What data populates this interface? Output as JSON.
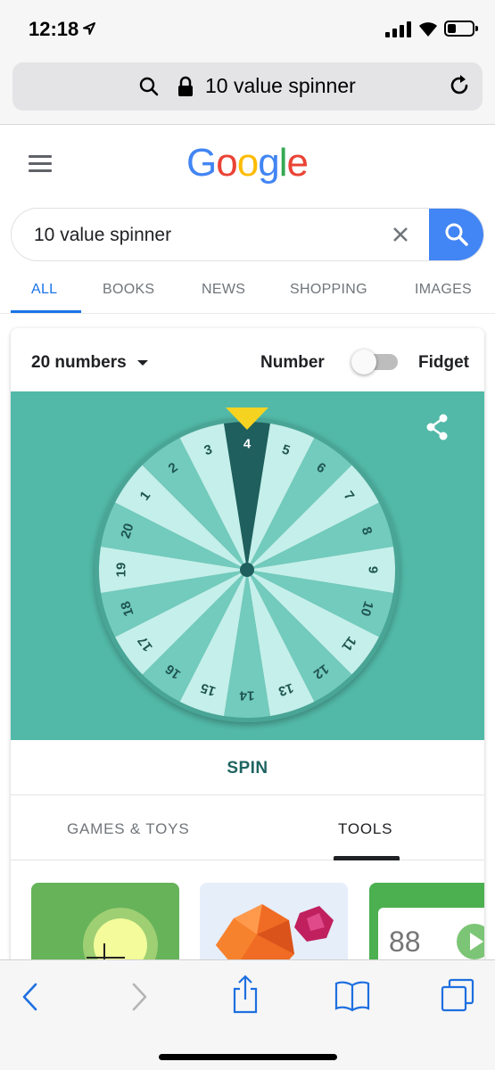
{
  "status": {
    "time": "12:18"
  },
  "browser": {
    "url_text": "10 value spinner"
  },
  "google": {
    "logo": [
      {
        "ch": "G",
        "color": "#4285f4"
      },
      {
        "ch": "o",
        "color": "#ea4335"
      },
      {
        "ch": "o",
        "color": "#fbbc05"
      },
      {
        "ch": "g",
        "color": "#4285f4"
      },
      {
        "ch": "l",
        "color": "#34a853"
      },
      {
        "ch": "e",
        "color": "#ea4335"
      }
    ],
    "search_value": "10 value spinner",
    "tabs": [
      "ALL",
      "BOOKS",
      "NEWS",
      "SHOPPING",
      "IMAGES"
    ],
    "active_tab": "ALL"
  },
  "spinner": {
    "count_label": "20 numbers",
    "mode_number": "Number",
    "mode_fidget": "Fidget",
    "fidget_enabled": false,
    "numbers": [
      "1",
      "2",
      "3",
      "4",
      "5",
      "6",
      "7",
      "8",
      "9",
      "10",
      "11",
      "12",
      "13",
      "14",
      "15",
      "16",
      "17",
      "18",
      "19",
      "20"
    ],
    "selected": "4",
    "spin_label": "SPIN",
    "colors": {
      "panel": "#52b9a8",
      "light": "#c5efea",
      "mid": "#72cbbd",
      "selected": "#1f5f5e",
      "pointer": "#f7d321",
      "text": "#1f5550"
    }
  },
  "categories": {
    "games": "GAMES & TOYS",
    "tools": "TOOLS",
    "active": "TOOLS"
  },
  "tiles": {
    "counter_value": "88"
  }
}
